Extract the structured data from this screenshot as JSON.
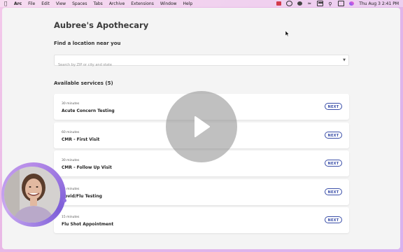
{
  "menubar": {
    "app_name": "Arc",
    "items": [
      "File",
      "Edit",
      "View",
      "Spaces",
      "Tabs",
      "Archive",
      "Extensions",
      "Window",
      "Help"
    ],
    "clock": "Thu Aug 3  2:41 PM"
  },
  "page": {
    "title": "Aubree's Apothecary",
    "find_label": "Find a location near you",
    "search_placeholder": "Search by ZIP or city and state",
    "services_heading": "Available services (5)",
    "next_label": "NEXT",
    "services": [
      {
        "duration": "30 minutes",
        "name": "Acute Concern Testing"
      },
      {
        "duration": "60 minutes",
        "name": "CMR - First Visit"
      },
      {
        "duration": "30 minutes",
        "name": "CMR - Follow Up Visit"
      },
      {
        "duration": "15 minutes",
        "name": "Covid/Flu Testing"
      },
      {
        "duration": "15 minutes",
        "name": "Flu Shot Appointment"
      }
    ]
  },
  "colors": {
    "accent": "#3a4ea8",
    "desktop": "#e8b7e6"
  },
  "icons": [
    "apple-icon",
    "wifi-icon",
    "battery-icon",
    "search-icon",
    "control-center-icon",
    "siri-icon",
    "play-icon",
    "dropdown-caret-icon",
    "mouse-cursor-icon"
  ]
}
